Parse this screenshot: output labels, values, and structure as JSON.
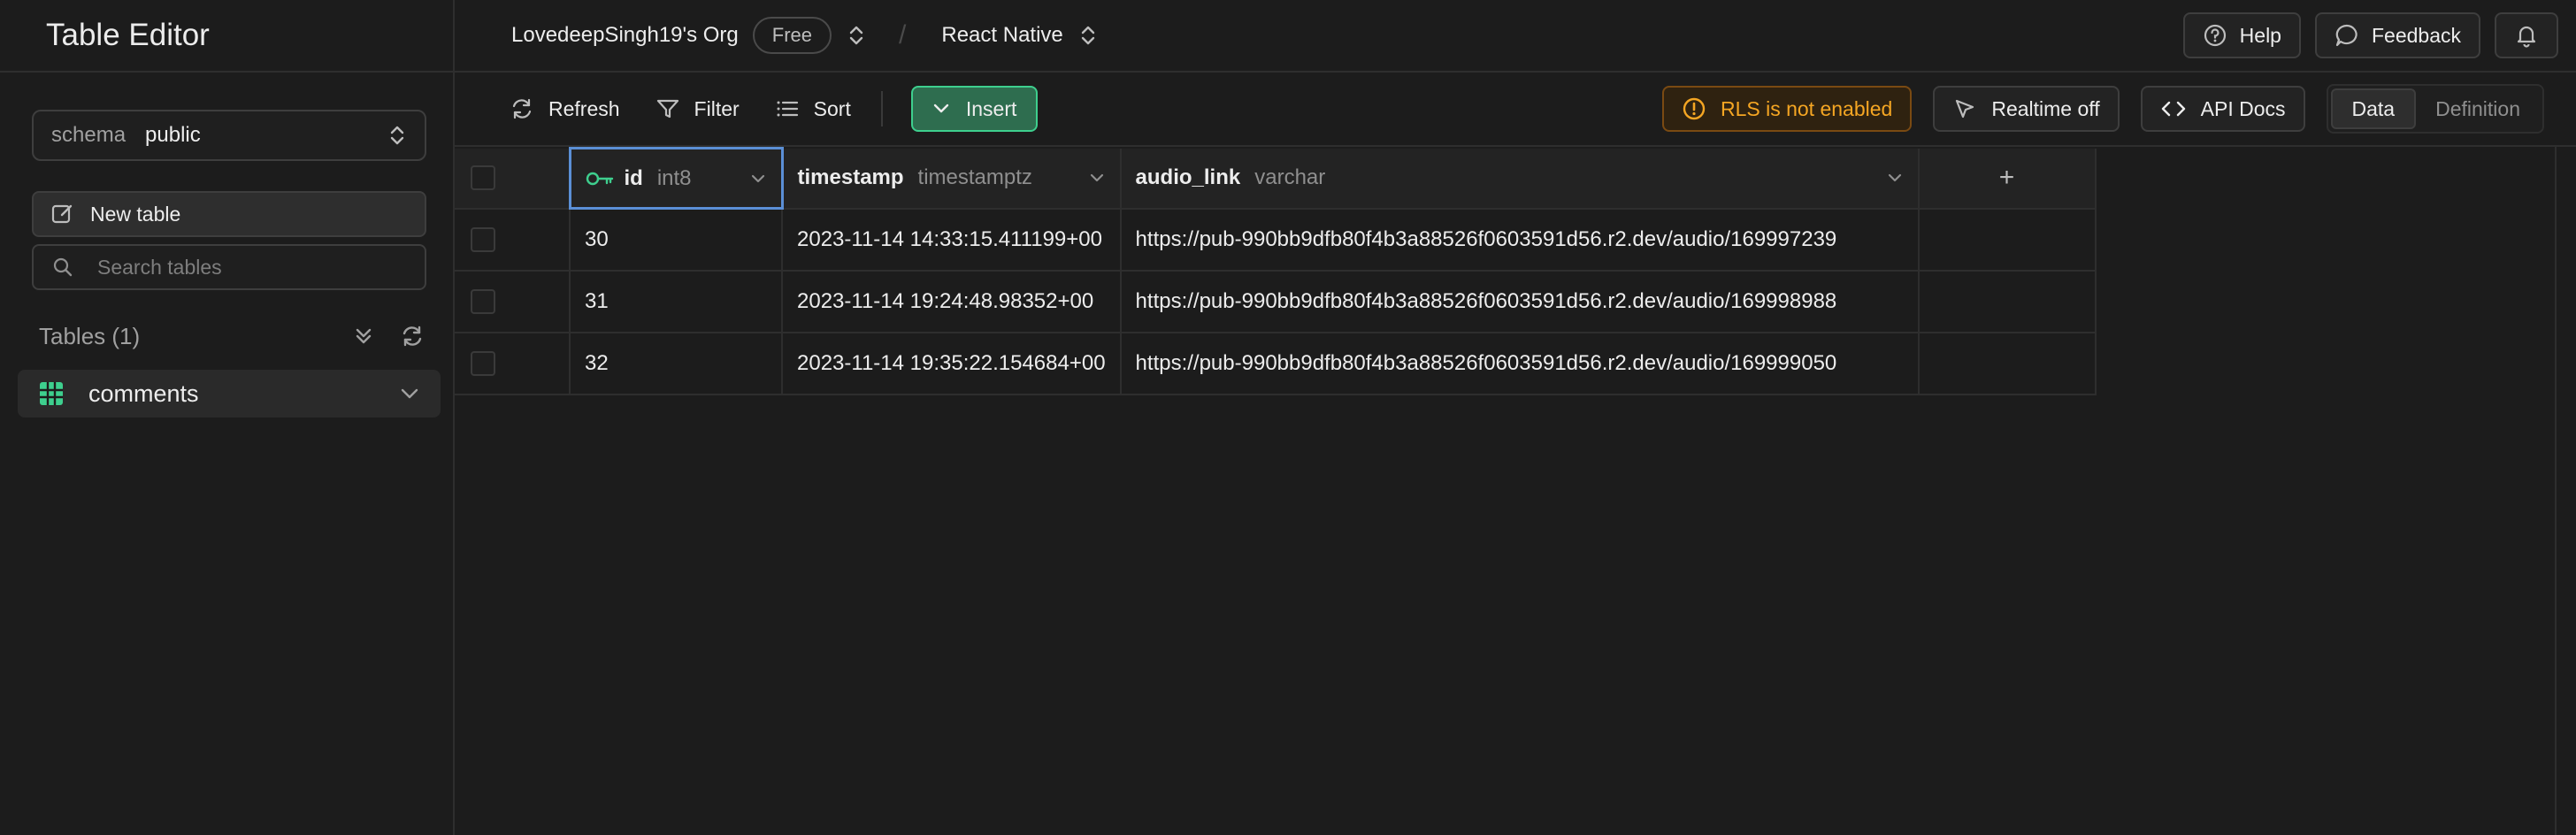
{
  "app": {
    "title": "Table Editor"
  },
  "sidebar": {
    "schema_label": "schema",
    "schema_value": "public",
    "new_table_label": "New table",
    "search_placeholder": "Search tables",
    "tables_title": "Tables (1)",
    "tables": [
      {
        "name": "comments"
      }
    ]
  },
  "topbar": {
    "org": "LovedeepSingh19's Org",
    "plan": "Free",
    "separator": "/",
    "project": "React Native",
    "help_label": "Help",
    "feedback_label": "Feedback"
  },
  "toolbar": {
    "refresh_label": "Refresh",
    "filter_label": "Filter",
    "sort_label": "Sort",
    "insert_label": "Insert",
    "rls_label": "RLS is not enabled",
    "realtime_label": "Realtime off",
    "api_docs_label": "API Docs",
    "view_data_label": "Data",
    "view_definition_label": "Definition"
  },
  "grid": {
    "columns": [
      {
        "name": "id",
        "type": "int8"
      },
      {
        "name": "timestamp",
        "type": "timestamptz"
      },
      {
        "name": "audio_link",
        "type": "varchar"
      }
    ],
    "add_column_label": "+",
    "rows": [
      {
        "id": "30",
        "timestamp": "2023-11-14 14:33:15.411199+00",
        "audio_link": "https://pub-990bb9dfb80f4b3a88526f0603591d56.r2.dev/audio/169997239"
      },
      {
        "id": "31",
        "timestamp": "2023-11-14 19:24:48.98352+00",
        "audio_link": "https://pub-990bb9dfb80f4b3a88526f0603591d56.r2.dev/audio/169998988"
      },
      {
        "id": "32",
        "timestamp": "2023-11-14 19:35:22.154684+00",
        "audio_link": "https://pub-990bb9dfb80f4b3a88526f0603591d56.r2.dev/audio/169999050"
      }
    ]
  },
  "colors": {
    "accent": "#3ecf8e",
    "warning": "#f5a623",
    "selected_border": "#5b8fd6"
  }
}
